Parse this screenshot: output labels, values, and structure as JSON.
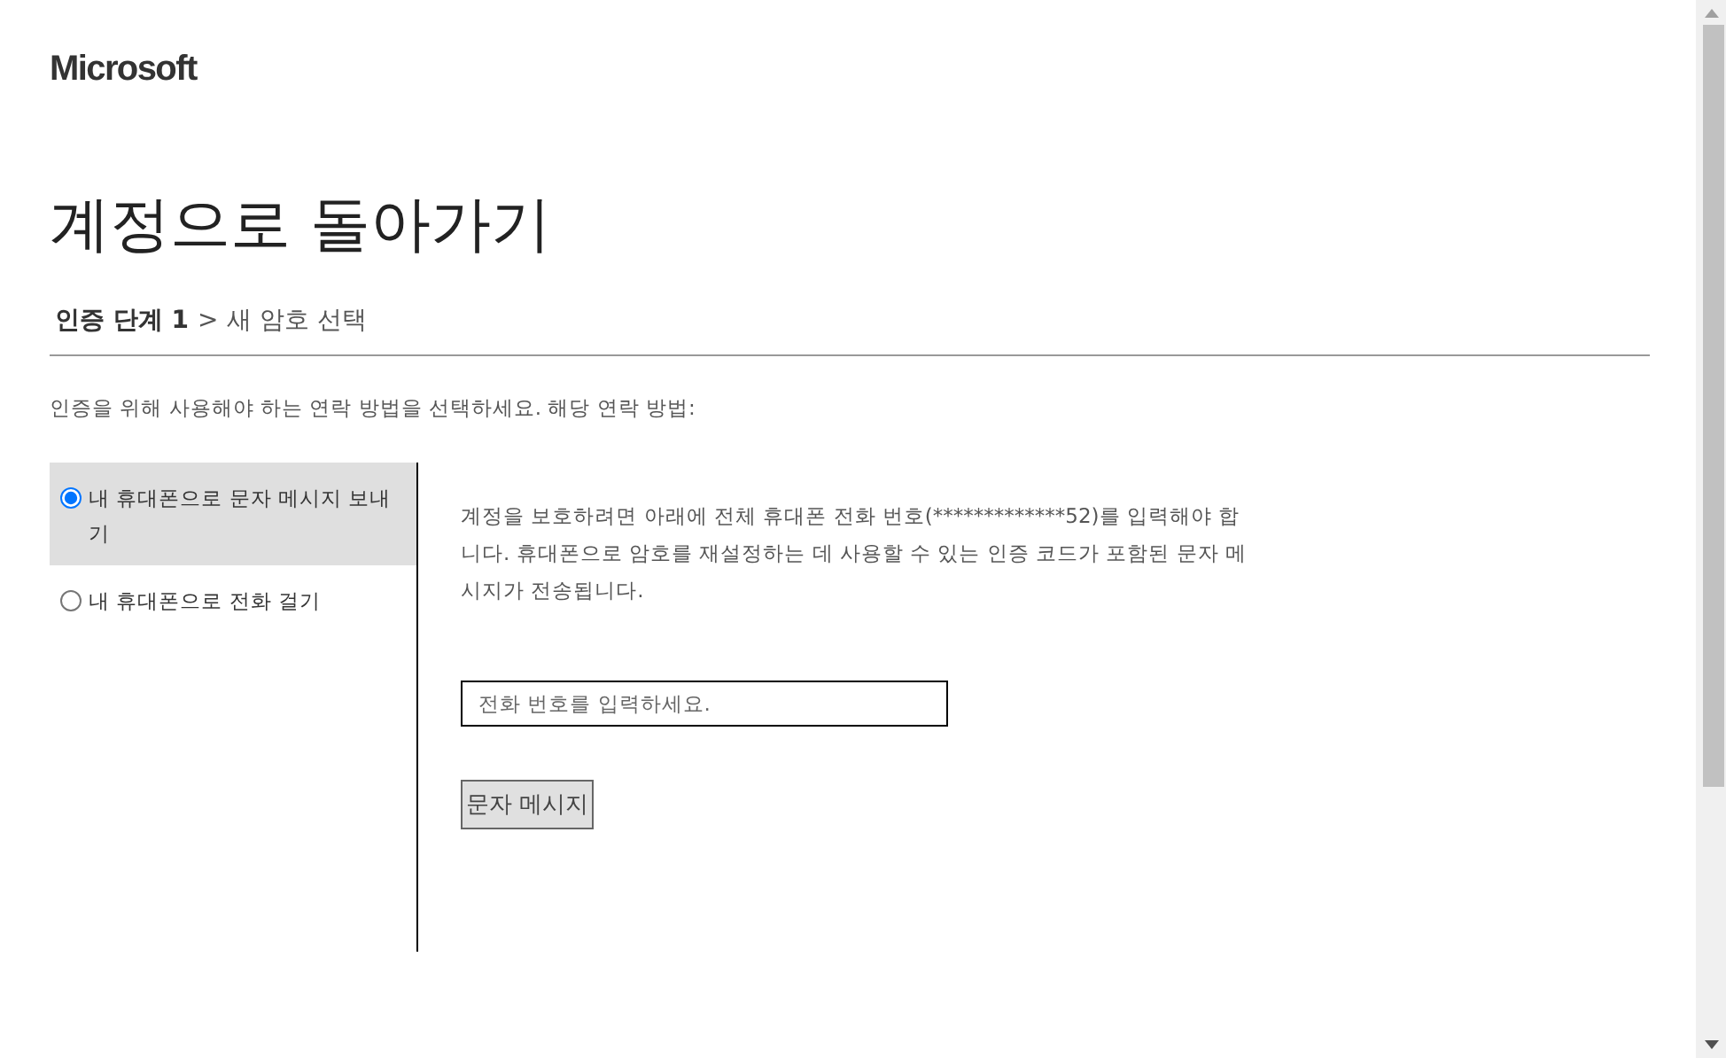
{
  "logo": {
    "text": "Microsoft"
  },
  "title": "계정으로 돌아가기",
  "breadcrumb": {
    "separator": ">",
    "steps": [
      {
        "label": "인증 단계 1",
        "current": true
      },
      {
        "label": "새 암호 선택",
        "current": false
      }
    ]
  },
  "instruction": "인증을 위해 사용해야 하는 연락 방법을 선택하세요. 해당 연락 방법:",
  "options": [
    {
      "label": "내 휴대폰으로 문자 메시지 보내기",
      "selected": true
    },
    {
      "label": "내 휴대폰으로 전화 걸기",
      "selected": false
    }
  ],
  "detail": {
    "text": "계정을 보호하려면 아래에 전체 휴대폰 전화 번호(*************52)를 입력해야 합니다. 휴대폰으로 암호를 재설정하는 데 사용할 수 있는 인증 코드가 포함된 문자 메시지가 전송됩니다.",
    "phone_field": {
      "placeholder": "전화 번호를 입력하세요."
    },
    "button": "문자 메시지"
  }
}
